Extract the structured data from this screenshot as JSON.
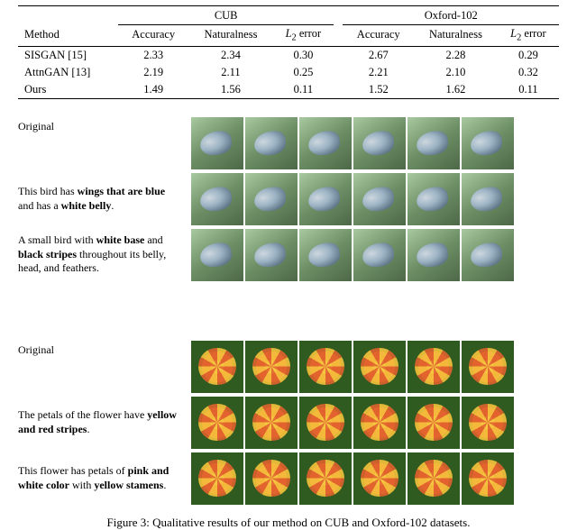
{
  "chart_data": {
    "type": "table",
    "title": "Comparison on CUB and Oxford-102",
    "datasets": [
      "CUB",
      "Oxford-102"
    ],
    "metrics": [
      "Accuracy",
      "Naturalness",
      "L2 error"
    ],
    "rows": [
      {
        "method": "SISGAN [15]",
        "cub": [
          2.33,
          2.34,
          0.3
        ],
        "oxford": [
          2.67,
          2.28,
          0.29
        ]
      },
      {
        "method": "AttnGAN [13]",
        "cub": [
          2.19,
          2.11,
          0.25
        ],
        "oxford": [
          2.21,
          2.1,
          0.32
        ]
      },
      {
        "method": "Ours",
        "cub": [
          1.49,
          1.56,
          0.11
        ],
        "oxford": [
          1.52,
          1.62,
          0.11
        ]
      }
    ]
  },
  "table": {
    "method_header": "Method",
    "group1": "CUB",
    "group2": "Oxford-102",
    "col_acc": "Accuracy",
    "col_nat": "Naturalness",
    "col_l2a": "L",
    "col_l2b": "2",
    "col_l2c": " error",
    "r0": {
      "m": "SISGAN [15]",
      "c0": "2.33",
      "c1": "2.34",
      "c2": "0.30",
      "o0": "2.67",
      "o1": "2.28",
      "o2": "0.29"
    },
    "r1": {
      "m": "AttnGAN [13]",
      "c0": "2.19",
      "c1": "2.11",
      "c2": "0.25",
      "o0": "2.21",
      "o1": "2.10",
      "o2": "0.32"
    },
    "r2": {
      "m": "Ours",
      "c0": "1.49",
      "c1": "1.56",
      "c2": "0.11",
      "o0": "1.52",
      "o1": "1.62",
      "o2": "0.11"
    }
  },
  "figure": {
    "row0": "Original",
    "row1a": "This bird has ",
    "row1b": "wings that are blue",
    "row1c": " and has a ",
    "row1d": "white belly",
    "row1e": ".",
    "row2a": "A small bird with ",
    "row2b": "white base",
    "row2c": " and ",
    "row2d": "black stripes",
    "row2e": " throughout its belly, head, and feathers.",
    "row3": "Original",
    "row4a": "The petals of the flower have ",
    "row4b": "yellow and red stripes",
    "row4c": ".",
    "row5a": "This flower has petals of ",
    "row5b": "pink and white color",
    "row5c": " with ",
    "row5d": "yellow stamens",
    "row5e": "."
  },
  "caption": "Figure 3: Qualitative results of our method on CUB and Oxford-102 datasets."
}
